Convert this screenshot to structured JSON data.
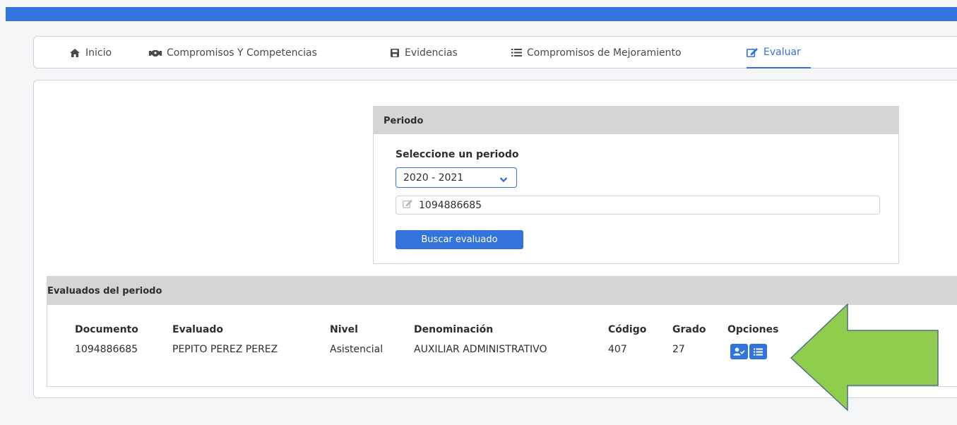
{
  "nav": {
    "tabs": [
      {
        "label": "Inicio",
        "icon": "home-icon"
      },
      {
        "label": "Compromisos Y Competencias",
        "icon": "handshake-icon"
      },
      {
        "label": "Evidencias",
        "icon": "save-icon"
      },
      {
        "label": "Compromisos de Mejoramiento",
        "icon": "list-icon"
      },
      {
        "label": "Evaluar",
        "icon": "edit-icon",
        "active": true
      }
    ]
  },
  "periodo": {
    "title": "Periodo",
    "select_label": "Seleccione un periodo",
    "selected": "2020 - 2021",
    "document_value": "1094886685",
    "search_button": "Buscar evaluado"
  },
  "evaluados": {
    "title": "Evaluados del periodo",
    "columns": [
      "Documento",
      "Evaluado",
      "Nivel",
      "Denominación",
      "Código",
      "Grado",
      "Opciones"
    ],
    "rows": [
      [
        "1094886685",
        "PEPITO PEREZ PEREZ",
        "Asistencial",
        "AUXILIAR ADMINISTRATIVO",
        "407",
        "27"
      ]
    ]
  },
  "colors": {
    "primary": "#3273dc",
    "header_gray": "#d5d5d5",
    "annotation_arrow": "#8fce4c"
  }
}
